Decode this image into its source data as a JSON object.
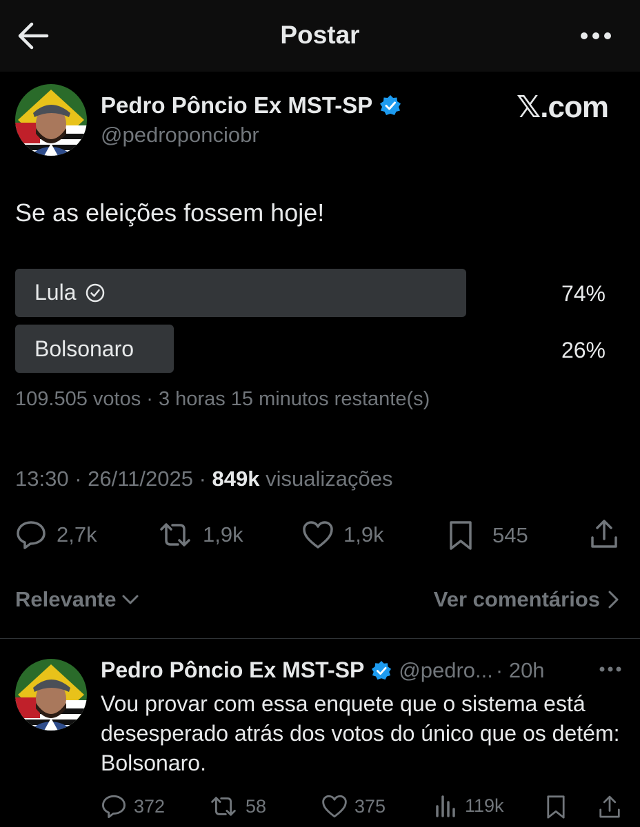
{
  "header": {
    "title": "Postar",
    "back_icon": "arrow-left-icon",
    "more_icon": "more-horizontal-icon"
  },
  "post": {
    "author_name": "Pedro Pôncio Ex MST-SP",
    "author_handle": "@pedroponciobr",
    "brand": "𝕏.com",
    "text": "Se as eleições fossem hoje!",
    "poll": {
      "options": [
        {
          "label": "Lula",
          "percent_text": "74%",
          "fraction": 0.74,
          "chosen": true
        },
        {
          "label": "Bolsonaro",
          "percent_text": "26%",
          "fraction": 0.26,
          "chosen": false
        }
      ],
      "summary": "109.505 votos · 3 horas 15 minutos restante(s)"
    },
    "time": "13:30 · 26/11/2025 · ",
    "views_count": "849k",
    "views_label": " visualizações",
    "actions": {
      "replies": "2,7k",
      "reposts": "1,9k",
      "likes": "1,9k",
      "bookmarks": "545"
    }
  },
  "comments_bar": {
    "sort_label": "Relevante",
    "see_comments": "Ver comentários"
  },
  "reply": {
    "author_name": "Pedro Pôncio Ex MST-SP",
    "handle": "@pedro...",
    "time": "· 20h",
    "text": "Vou provar com essa enquete que o sistema está desesperado atrás dos votos do único que os detém: Bolsonaro.",
    "actions": {
      "replies": "372",
      "reposts": "58",
      "likes": "375",
      "views": "119k"
    }
  },
  "colors": {
    "background": "#000000",
    "text": "#e7e9ea",
    "muted": "#71767b",
    "verified": "#1d9bf0",
    "poll_bar": "#333639"
  }
}
